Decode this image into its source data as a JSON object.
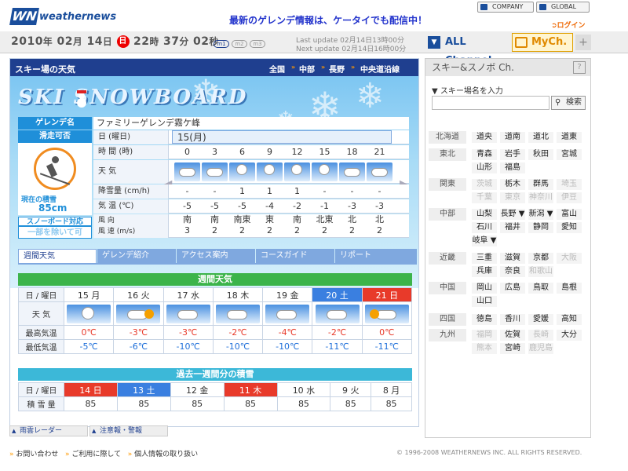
{
  "header": {
    "logo_text": "weathernews",
    "logo_mark": "WN",
    "promo": "最新のゲレンデ情報は、ケータイでも配信中！",
    "company": "COMPANY",
    "global": "GLOBAL",
    "login": "ログイン"
  },
  "datebar": {
    "year": "2010",
    "yl": "年",
    "month": "02",
    "ml": "月",
    "day": "14",
    "dl": "日",
    "dow": "日",
    "hour": "22",
    "hl": "時",
    "min": "37",
    "mnl": "分",
    "sec": "02",
    "sl": "秒",
    "pills": [
      "m1",
      "m2",
      "m3"
    ],
    "last_update": "Last update  02月14日13時00分",
    "next_update": "Next update  02月14日16時00分",
    "all_channel": "ALL Channel",
    "mych": "MyCh.",
    "plus": "+"
  },
  "main": {
    "title": "スキー場の天気",
    "crumbs": [
      "全国",
      "中部",
      "長野",
      "中央道沿線"
    ],
    "banner_title": "SKI SNOWBOARD",
    "slope_label": "ゲレンデ名",
    "slope_name": "ファミリーゲレンデ霧ケ峰",
    "ski_status": "滑走可否",
    "snow_depth_label": "現在の積雪",
    "snow_depth": "85cm",
    "snowboard_label": "スノーボード対応",
    "snowboard_value": "一部を除いて可"
  },
  "hourly": {
    "date_label": "日 (曜日)",
    "date_value": "15(月)",
    "time_label": "時 間 (時)",
    "hours": [
      "0",
      "3",
      "6",
      "9",
      "12",
      "15",
      "18",
      "21"
    ],
    "weather_label": "天 気",
    "snow_label": "降雪量 (cm/h)",
    "snow": [
      "-",
      "-",
      "1",
      "1",
      "1",
      "-",
      "-",
      "-"
    ],
    "temp_label": "気 温 (℃)",
    "temp": [
      "-5",
      "-5",
      "-5",
      "-4",
      "-2",
      "-1",
      "-3",
      "-3"
    ],
    "wind_label1": "風 向",
    "wind_label2": "風 速 (m/s)",
    "wind_dir": [
      "南",
      "南",
      "南東",
      "東",
      "南",
      "北東",
      "北",
      "北"
    ],
    "wind_speed": [
      "3",
      "2",
      "2",
      "2",
      "2",
      "2",
      "2",
      "2"
    ]
  },
  "tabs": [
    "週間天気",
    "ゲレンデ紹介",
    "アクセス案内",
    "コースガイド",
    "リポート"
  ],
  "weekly": {
    "title": "週間天気",
    "head": "日 / 曜日",
    "days": [
      "15 月",
      "16 火",
      "17 水",
      "18 木",
      "19 金",
      "20 土",
      "21 日"
    ],
    "weather_label": "天 気",
    "high_label": "最高気温",
    "highs": [
      "0℃",
      "-3℃",
      "-3℃",
      "-2℃",
      "-4℃",
      "-2℃",
      "0℃"
    ],
    "low_label": "最低気温",
    "lows": [
      "-5℃",
      "-6℃",
      "-10℃",
      "-10℃",
      "-10℃",
      "-11℃",
      "-11℃"
    ]
  },
  "history": {
    "title": "過去一週間分の積雪",
    "head": "日 / 曜日",
    "days": [
      "14 日",
      "13 土",
      "12 金",
      "11 木",
      "10 水",
      "9 火",
      "8 月"
    ],
    "depth_label": "積 雪 量",
    "depth": [
      "85",
      "85",
      "85",
      "85",
      "85",
      "85",
      "85"
    ]
  },
  "footer_buttons": [
    "雨雲レーダー",
    "注意報・警報"
  ],
  "sidebar": {
    "title": "スキー&スノボ Ch.",
    "help": "?",
    "search_label": "▼ スキー場名を入力",
    "search_btn": "検索",
    "regions": [
      {
        "name": "北海道",
        "prefs": [
          [
            "道央",
            0
          ],
          [
            "道南",
            0
          ],
          [
            "道北",
            0
          ],
          [
            "道東",
            0
          ]
        ]
      },
      {
        "name": "東北",
        "prefs": [
          [
            "青森",
            0
          ],
          [
            "岩手",
            0
          ],
          [
            "秋田",
            0
          ],
          [
            "宮城",
            0
          ],
          [
            "山形",
            0
          ],
          [
            "福島",
            0
          ]
        ]
      },
      {
        "name": "関東",
        "prefs": [
          [
            "茨城",
            1
          ],
          [
            "栃木",
            0
          ],
          [
            "群馬",
            0
          ],
          [
            "埼玉",
            1
          ],
          [
            "千葉",
            1
          ],
          [
            "東京",
            1
          ],
          [
            "神奈川",
            1
          ],
          [
            "伊豆",
            1
          ]
        ]
      },
      {
        "name": "中部",
        "prefs": [
          [
            "山梨",
            0
          ],
          [
            "長野 ▼",
            0
          ],
          [
            "新潟 ▼",
            0
          ],
          [
            "富山",
            0
          ],
          [
            "石川",
            0
          ],
          [
            "福井",
            0
          ],
          [
            "静岡",
            0
          ],
          [
            "愛知",
            0
          ],
          [
            "岐阜 ▼",
            0
          ]
        ]
      },
      {
        "name": "近畿",
        "prefs": [
          [
            "三重",
            0
          ],
          [
            "滋賀",
            0
          ],
          [
            "京都",
            0
          ],
          [
            "大阪",
            1
          ],
          [
            "兵庫",
            0
          ],
          [
            "奈良",
            0
          ],
          [
            "和歌山",
            1
          ]
        ]
      },
      {
        "name": "中国",
        "prefs": [
          [
            "岡山",
            0
          ],
          [
            "広島",
            0
          ],
          [
            "鳥取",
            0
          ],
          [
            "島根",
            0
          ],
          [
            "山口",
            0
          ]
        ]
      },
      {
        "name": "四国",
        "prefs": [
          [
            "徳島",
            0
          ],
          [
            "香川",
            0
          ],
          [
            "愛媛",
            0
          ],
          [
            "高知",
            0
          ]
        ]
      },
      {
        "name": "九州",
        "prefs": [
          [
            "福岡",
            1
          ],
          [
            "佐賀",
            0
          ],
          [
            "長崎",
            1
          ],
          [
            "大分",
            0
          ],
          [
            "熊本",
            1
          ],
          [
            "宮崎",
            0
          ],
          [
            "鹿児島",
            1
          ]
        ]
      }
    ]
  },
  "bottom": {
    "links": [
      "お問い合わせ",
      "ご利用に際して",
      "個人情報の取り扱い"
    ],
    "copyright": "© 1996-2008 WEATHERNEWS INC. ALL RIGHTS RESERVED."
  },
  "colors": {
    "navy": "#1f3f8f",
    "green": "#3cb44a",
    "cyan": "#3cb8d8",
    "sat": "#3a7fe0",
    "sun": "#e83a2a"
  }
}
